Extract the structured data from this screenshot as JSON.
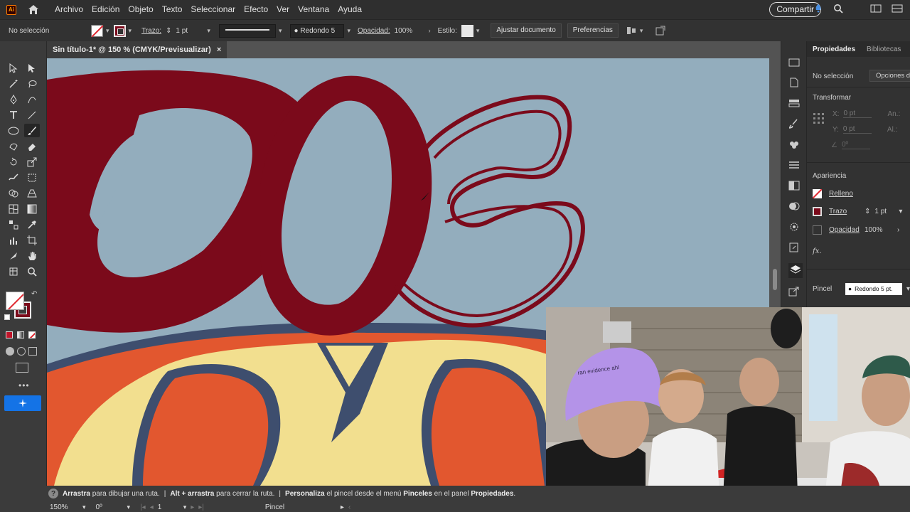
{
  "app": {
    "logo": "Ai"
  },
  "menu": [
    "Archivo",
    "Edición",
    "Objeto",
    "Texto",
    "Seleccionar",
    "Efecto",
    "Ver",
    "Ventana",
    "Ayuda"
  ],
  "share_label": "Compartir",
  "control_bar": {
    "selection": "No selección",
    "stroke_label": "Trazo:",
    "stroke_weight": "1 pt",
    "profile": "Uniforme",
    "brush": "Redondo 5 ...",
    "opacity_label": "Opacidad:",
    "opacity_value": "100%",
    "style_label": "Estilo:",
    "align_doc": "Ajustar documento",
    "preferences": "Preferencias"
  },
  "doc_tab": {
    "title": "Sin título-1* @ 150 % (CMYK/Previsualizar)",
    "close": "×"
  },
  "props_panel": {
    "tab_properties": "Propiedades",
    "tab_libraries": "Bibliotecas",
    "selection": "No selección",
    "options_button": "Opciones de herr",
    "transform_title": "Transformar",
    "x_label": "X:",
    "x_value": "0 pt",
    "y_label": "Y:",
    "y_value": "0 pt",
    "w_label": "An.:",
    "h_label": "Al.:",
    "angle_value": "0º",
    "appearance_title": "Apariencia",
    "fill_label": "Relleno",
    "stroke_label": "Trazo",
    "stroke_value": "1 pt",
    "opacity_label": "Opacidad",
    "opacity_value": "100%",
    "fx_label": "fx.",
    "brush_label": "Pincel",
    "brush_value": "Redondo 5 pt."
  },
  "status": {
    "part1_bold": "Arrastra",
    "part1": "para dibujar una ruta.",
    "sep1": "|",
    "part2_bold": "Alt + arrastra",
    "part2": "para cerrar la ruta.",
    "sep2": "|",
    "part3_bold": "Personaliza",
    "part3": "el pincel desde el menú",
    "part3_bold2": "Pinceles",
    "part3b": "en el panel",
    "part3_bold3": "Propiedades",
    "part3_end": ".",
    "zoom": "150%",
    "rotation": "0º",
    "artboard": "1",
    "tool": "Pincel"
  },
  "colors": {
    "lettering": "#7b0a1b",
    "canvas_bg": "#93adbd",
    "orange": "#e2572f",
    "cream": "#f2df8f",
    "navy": "#3e4e6e"
  },
  "webcam": {
    "cap_text": "ran evidence ahl"
  }
}
